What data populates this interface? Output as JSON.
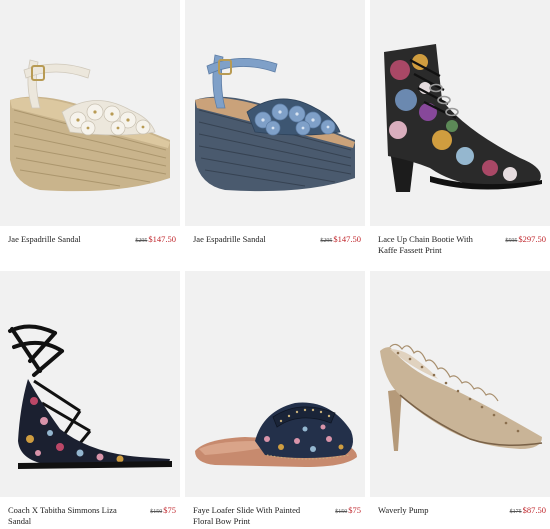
{
  "products": [
    {
      "name": "Jae Espadrille Sandal",
      "old_price": "$295",
      "sale_price": "$147.50",
      "image": "espadrille-sandal-cream-icon"
    },
    {
      "name": "Jae Espadrille Sandal",
      "old_price": "$295",
      "sale_price": "$147.50",
      "image": "espadrille-sandal-denim-icon"
    },
    {
      "name": "Lace Up Chain Bootie With Kaffe Fassett Print",
      "old_price": "$595",
      "sale_price": "$297.50",
      "image": "floral-chain-bootie-icon"
    },
    {
      "name": "Coach X Tabitha Simmons Liza Sandal",
      "old_price": "$150",
      "sale_price": "$75",
      "image": "lace-up-floral-sandal-icon"
    },
    {
      "name": "Faye Loafer Slide With Painted Floral Bow Print",
      "old_price": "$150",
      "sale_price": "$75",
      "image": "floral-loafer-slide-icon"
    },
    {
      "name": "Waverly Pump",
      "old_price": "$175",
      "sale_price": "$87.50",
      "image": "scalloped-pump-icon"
    }
  ],
  "colors": {
    "image_bg": "#f1f1f1",
    "sale_price": "#c0272d",
    "text": "#222222"
  }
}
